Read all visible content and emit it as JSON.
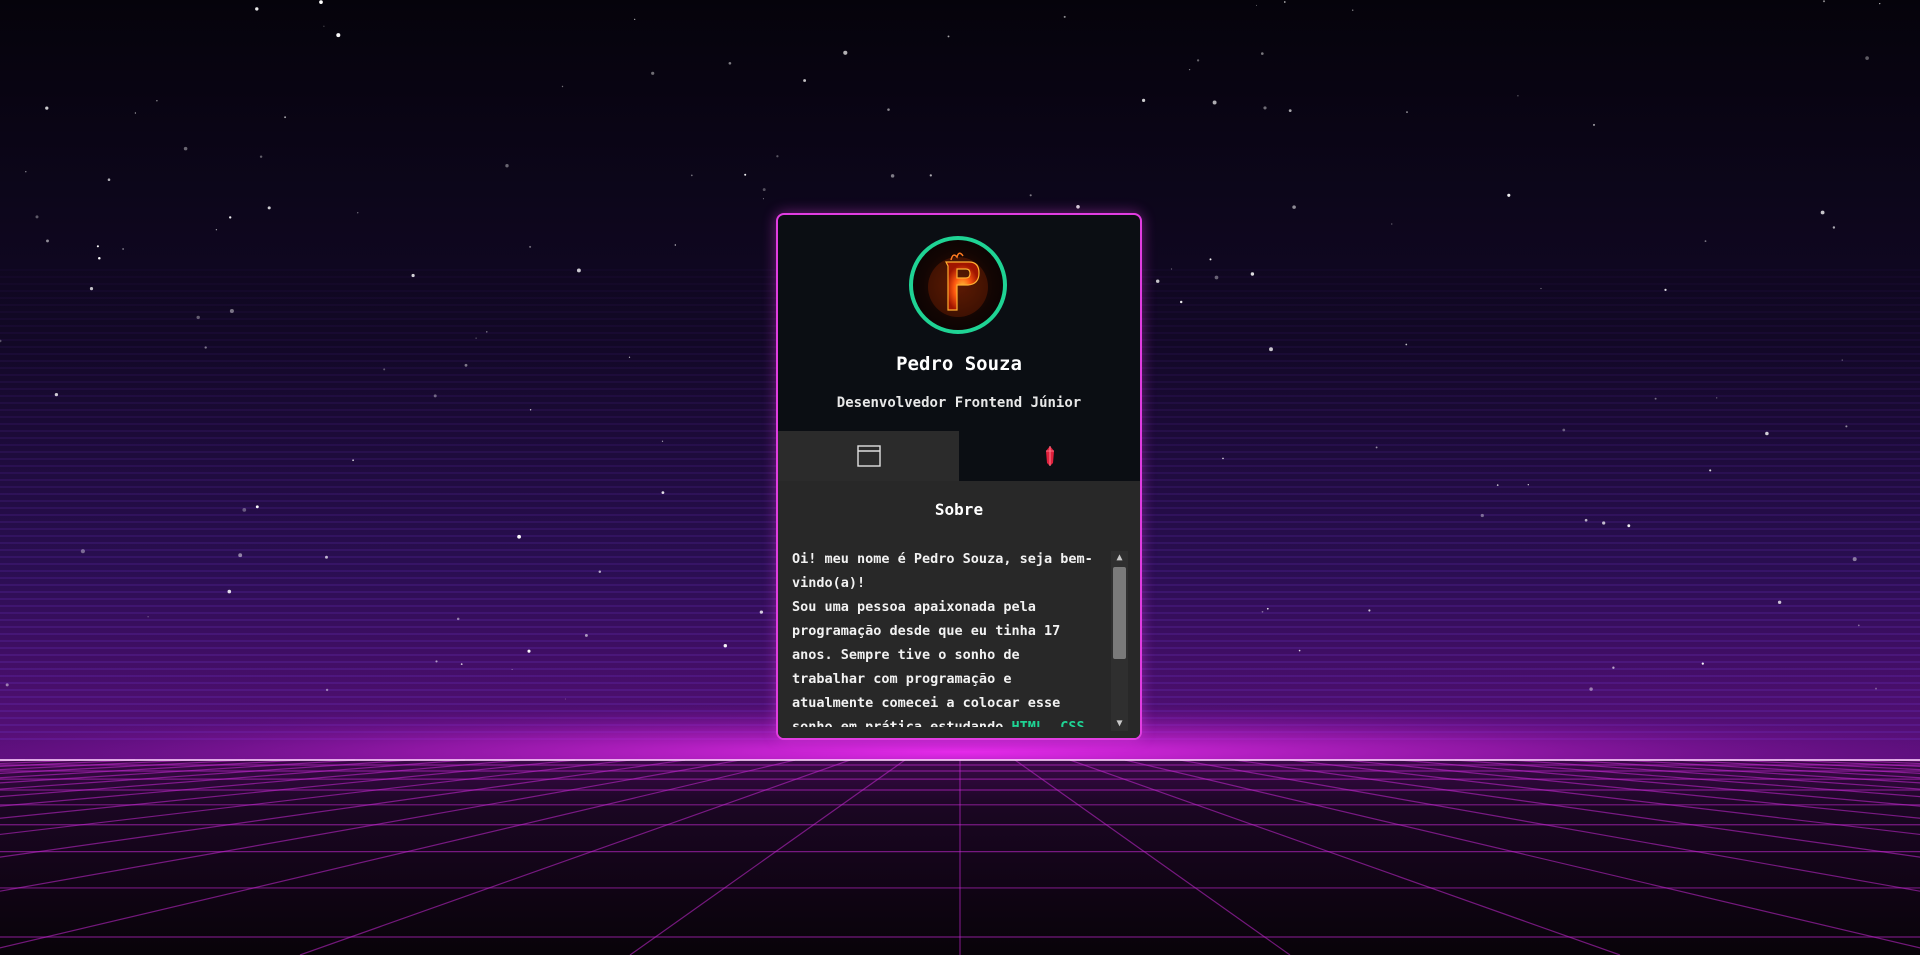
{
  "profile": {
    "name": "Pedro Souza",
    "role": "Desenvolvedor Frontend Júnior",
    "avatar_icon": "flaming-letter-p-icon",
    "avatar_border_color": "#1fd394"
  },
  "tabs": [
    {
      "icon": "browser-window-icon",
      "active": true
    },
    {
      "icon": "gem-crystal-icon",
      "active": false
    }
  ],
  "about": {
    "title": "Sobre",
    "line1": "Oi! meu nome é Pedro Souza, seja bem-vindo(a)!",
    "line2": "Sou uma pessoa apaixonada pela programação desde que eu tinha 17 anos. Sempre tive o sonho de trabalhar com programação e atualmente comecei a colocar esse sonho em prática estudando",
    "skills": "HTML, CSS e JavaScript"
  },
  "colors": {
    "accent": "#e23de2",
    "highlight": "#1fd394",
    "card_bg": "#0b0e13",
    "content_bg": "#282828"
  }
}
